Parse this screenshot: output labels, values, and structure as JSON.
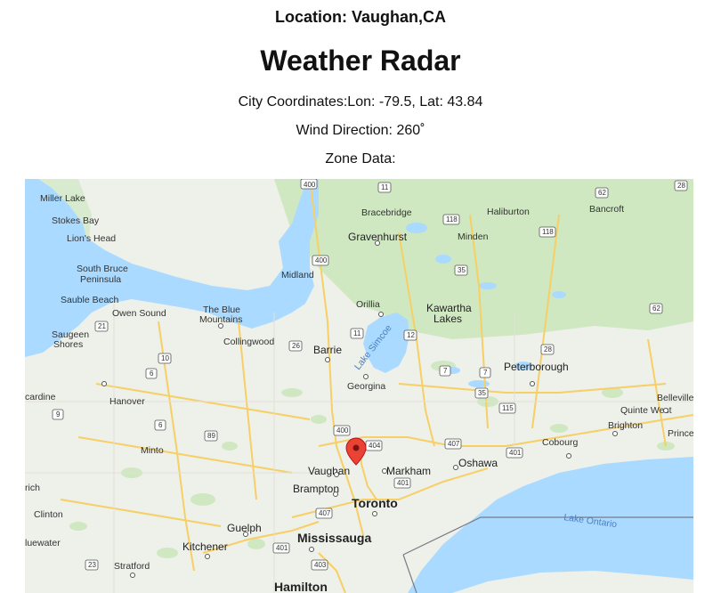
{
  "location_line": "Location: Vaughan,CA",
  "title": "Weather Radar",
  "coords_line": "City Coordinates:Lon: -79.5, Lat: 43.84",
  "wind_line": "Wind Direction: 260˚",
  "zone_line": "Zone Data:",
  "colors": {
    "land": "#eef0ea",
    "water": "#aadaff",
    "forest": "#cfe8c2",
    "road": "#f6cf65",
    "marker": "#ea4335"
  },
  "map": {
    "water_labels": {
      "lake_simcoe": "Lake Simcoe",
      "lake_ontario": "Lake Ontario"
    },
    "places": {
      "miller_lake": "Miller Lake",
      "stokes_bay": "Stokes Bay",
      "lions_head": "Lion's Head",
      "south_bruce_peninsula": "South Bruce Peninsula",
      "sauble_beach": "Sauble Beach",
      "owen_sound": "Owen Sound",
      "the_blue_mountains": "The Blue Mountains",
      "collingwood": "Collingwood",
      "saugeen_shores": "Saugeen Shores",
      "cardine": "cardine",
      "hanover": "Hanover",
      "minto": "Minto",
      "rich": "rich",
      "clinton": "Clinton",
      "luewater": "luewater",
      "stratford": "Stratford",
      "kitchener": "Kitchener",
      "guelph": "Guelph",
      "midland": "Midland",
      "orillia": "Orillia",
      "barrie": "Barrie",
      "georgina": "Georgina",
      "bracebridge": "Bracebridge",
      "gravenhurst": "Gravenhurst",
      "haliburton": "Haliburton",
      "minden": "Minden",
      "bancroft": "Bancroft",
      "kawartha_lakes": "Kawartha Lakes",
      "peterborough": "Peterborough",
      "belleville": "Belleville",
      "quinte_west": "Quinte West",
      "brighton": "Brighton",
      "cobourg": "Cobourg",
      "prince": "Prince",
      "oshawa": "Oshawa",
      "markham": "Markham",
      "vaughan": "Vaughan",
      "brampton": "Brampton",
      "toronto": "Toronto",
      "mississauga": "Mississauga",
      "hamilton": "Hamilton"
    },
    "shields": {
      "s400_top": "400",
      "s11_top": "11",
      "s62_top": "62",
      "s28_top": "28",
      "s118_a": "118",
      "s118_b": "118",
      "s400_mid": "400",
      "s35_a": "35",
      "s26": "26",
      "s62_right": "62",
      "s21": "21",
      "s10": "10",
      "s6_a": "6",
      "s11_mid": "11",
      "s12": "12",
      "s28_mid": "28",
      "s7_a": "7",
      "s7_b": "7",
      "s35_b": "35",
      "s115": "115",
      "s9": "9",
      "s6_b": "6",
      "s89": "89",
      "s400_low": "400",
      "s404": "404",
      "s407_east": "407",
      "s401_east": "401",
      "s401_mid": "401",
      "s407_low": "407",
      "s401_low": "401",
      "s403": "403",
      "s23": "23"
    }
  }
}
